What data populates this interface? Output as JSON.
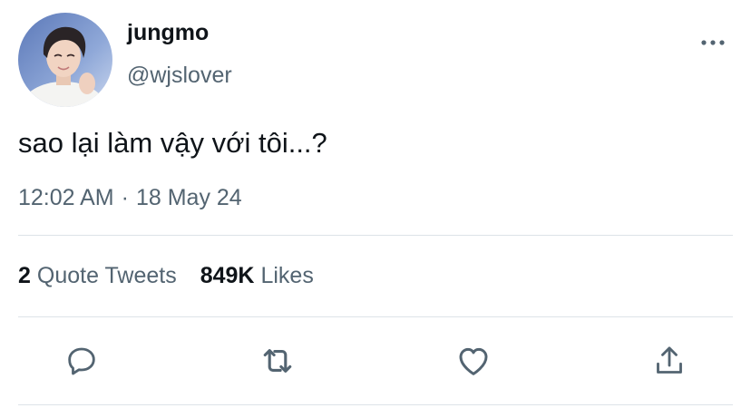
{
  "author": {
    "display_name": "jungmo",
    "handle": "@wjslover"
  },
  "tweet": {
    "text": "sao lại làm vậy với tôi...?",
    "time": "12:02 AM",
    "separator": "·",
    "date": "18 May 24"
  },
  "stats": {
    "quote_tweets_count": "2",
    "quote_tweets_label": "Quote Tweets",
    "likes_count": "849K",
    "likes_label": "Likes"
  },
  "icons": {
    "more": "more-horizontal-icon",
    "reply": "reply-icon",
    "retweet": "retweet-icon",
    "like": "like-icon",
    "share": "share-icon"
  },
  "colors": {
    "text_primary": "#0f1419",
    "text_secondary": "#536471",
    "divider": "#dde3e8",
    "icon": "#536471"
  }
}
